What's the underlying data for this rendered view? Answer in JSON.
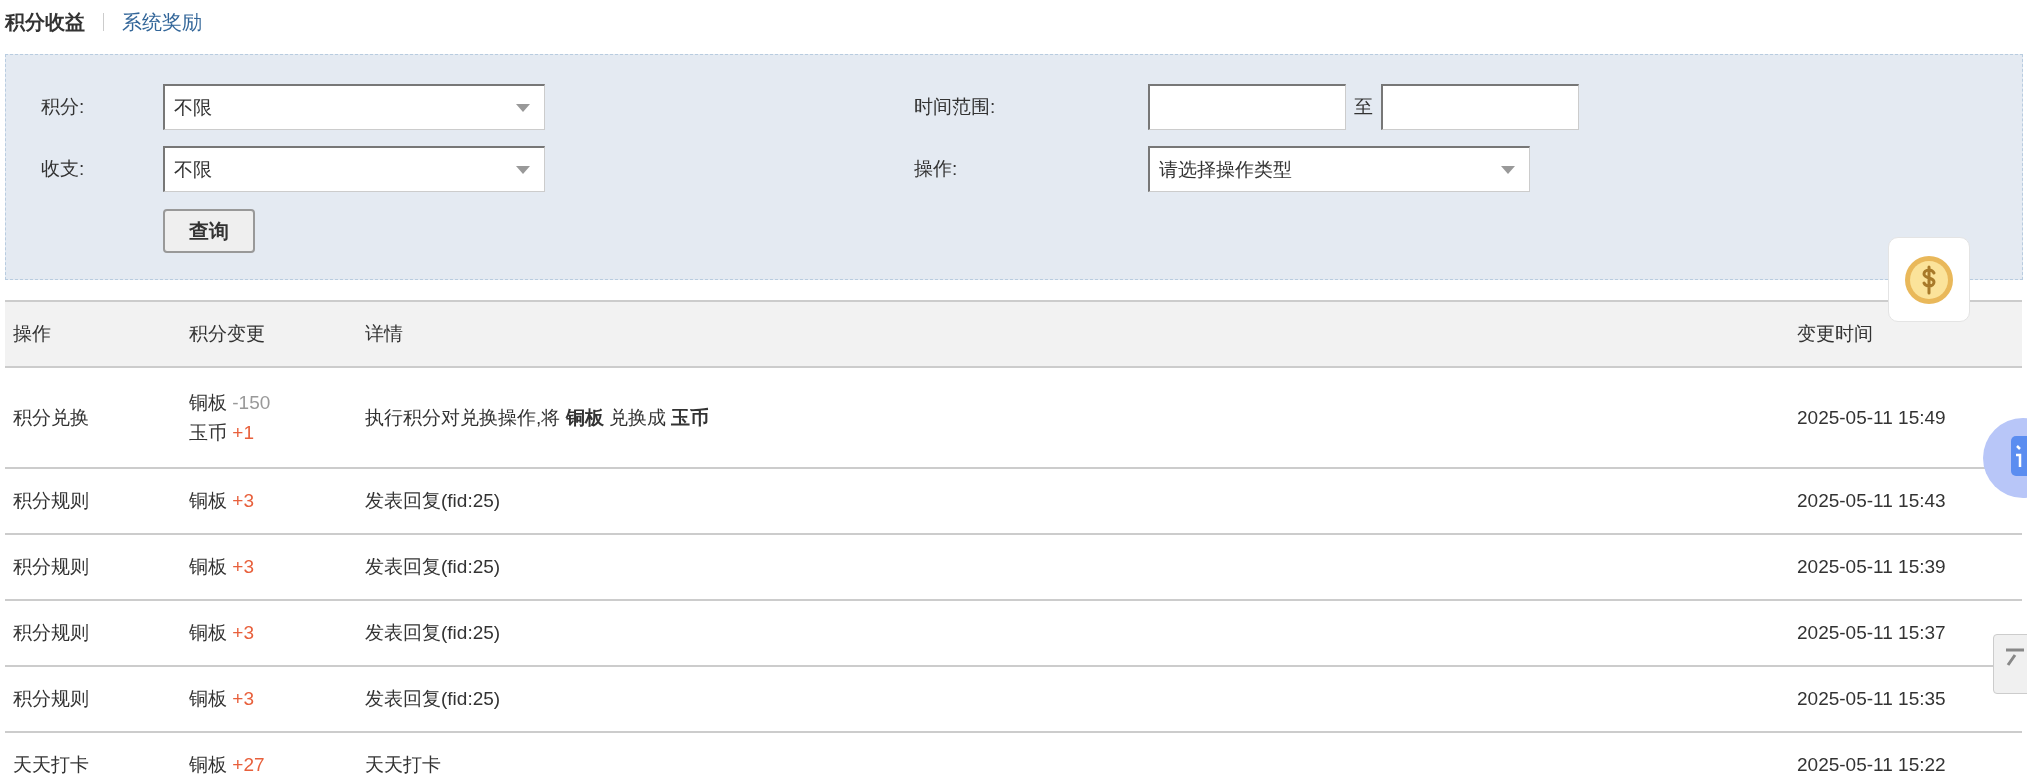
{
  "tabs": [
    {
      "label": "积分收益",
      "selected": true
    },
    {
      "label": "系统奖励",
      "selected": false
    }
  ],
  "filters": {
    "fields": [
      {
        "kind": "select",
        "label": "积分:",
        "value": "不限"
      },
      {
        "kind": "range",
        "label": "时间范围:",
        "separator": "至"
      },
      {
        "kind": "select",
        "label": "收支:",
        "value": "不限"
      },
      {
        "kind": "select",
        "label": "操作:",
        "value": "请选择操作类型"
      }
    ],
    "query_button": "查询"
  },
  "table": {
    "columns": [
      "操作",
      "积分变更",
      "详情",
      "变更时间"
    ],
    "rows": [
      {
        "operation": "积分兑换",
        "changes": [
          {
            "currency": "铜板",
            "amount": "-150",
            "kind": "negative"
          },
          {
            "currency": "玉币",
            "amount": "+1",
            "kind": "positive"
          }
        ],
        "detail": "执行积分对兑换操作,将 **铜板** 兑换成 **玉币**",
        "time": "2025-05-11 15:49"
      },
      {
        "operation": "积分规则",
        "changes": [
          {
            "currency": "铜板",
            "amount": "+3",
            "kind": "positive"
          }
        ],
        "detail": "发表回复(fid:25)",
        "time": "2025-05-11 15:43"
      },
      {
        "operation": "积分规则",
        "changes": [
          {
            "currency": "铜板",
            "amount": "+3",
            "kind": "positive"
          }
        ],
        "detail": "发表回复(fid:25)",
        "time": "2025-05-11 15:39"
      },
      {
        "operation": "积分规则",
        "changes": [
          {
            "currency": "铜板",
            "amount": "+3",
            "kind": "positive"
          }
        ],
        "detail": "发表回复(fid:25)",
        "time": "2025-05-11 15:37"
      },
      {
        "operation": "积分规则",
        "changes": [
          {
            "currency": "铜板",
            "amount": "+3",
            "kind": "positive"
          }
        ],
        "detail": "发表回复(fid:25)",
        "time": "2025-05-11 15:35"
      },
      {
        "operation": "天天打卡",
        "changes": [
          {
            "currency": "铜板",
            "amount": "+27",
            "kind": "positive"
          }
        ],
        "detail": "天天打卡",
        "time": "2025-05-11 15:22"
      }
    ]
  }
}
